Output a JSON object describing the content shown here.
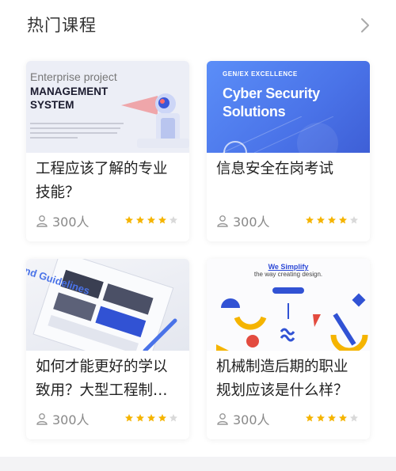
{
  "section": {
    "title": "热门课程"
  },
  "courses": [
    {
      "title": "工程应该了解的专业技能？",
      "enrolled": "300人",
      "rating": 4,
      "thumb": {
        "line1": "Enterprise project",
        "line2a": "MANAGEMENT",
        "line2b": "SYSTEM"
      }
    },
    {
      "title": "信息安全在岗考试",
      "enrolled": "300人",
      "rating": 4,
      "thumb": {
        "line1": "GEN/EX EXCELLENCE",
        "line2a": "Cyber Security",
        "line2b": "Solutions"
      }
    },
    {
      "title": "如何才能更好的学以致用？大型工程制…",
      "enrolled": "300人",
      "rating": 4,
      "thumb": {
        "line1": "nd Guidelines"
      }
    },
    {
      "title": "机械制造后期的职业规划应该是什么样？",
      "enrolled": "300人",
      "rating": 4,
      "thumb": {
        "line1": "We Simplify",
        "line2a": "the way creating design."
      }
    }
  ],
  "colors": {
    "star_on": "#f5b400",
    "star_off": "#d9d9d9",
    "accent_blue": "#4a73e8"
  },
  "icons": {
    "more": "chevron-right-icon",
    "enrolled": "user-icon",
    "rating": "star-icon"
  }
}
